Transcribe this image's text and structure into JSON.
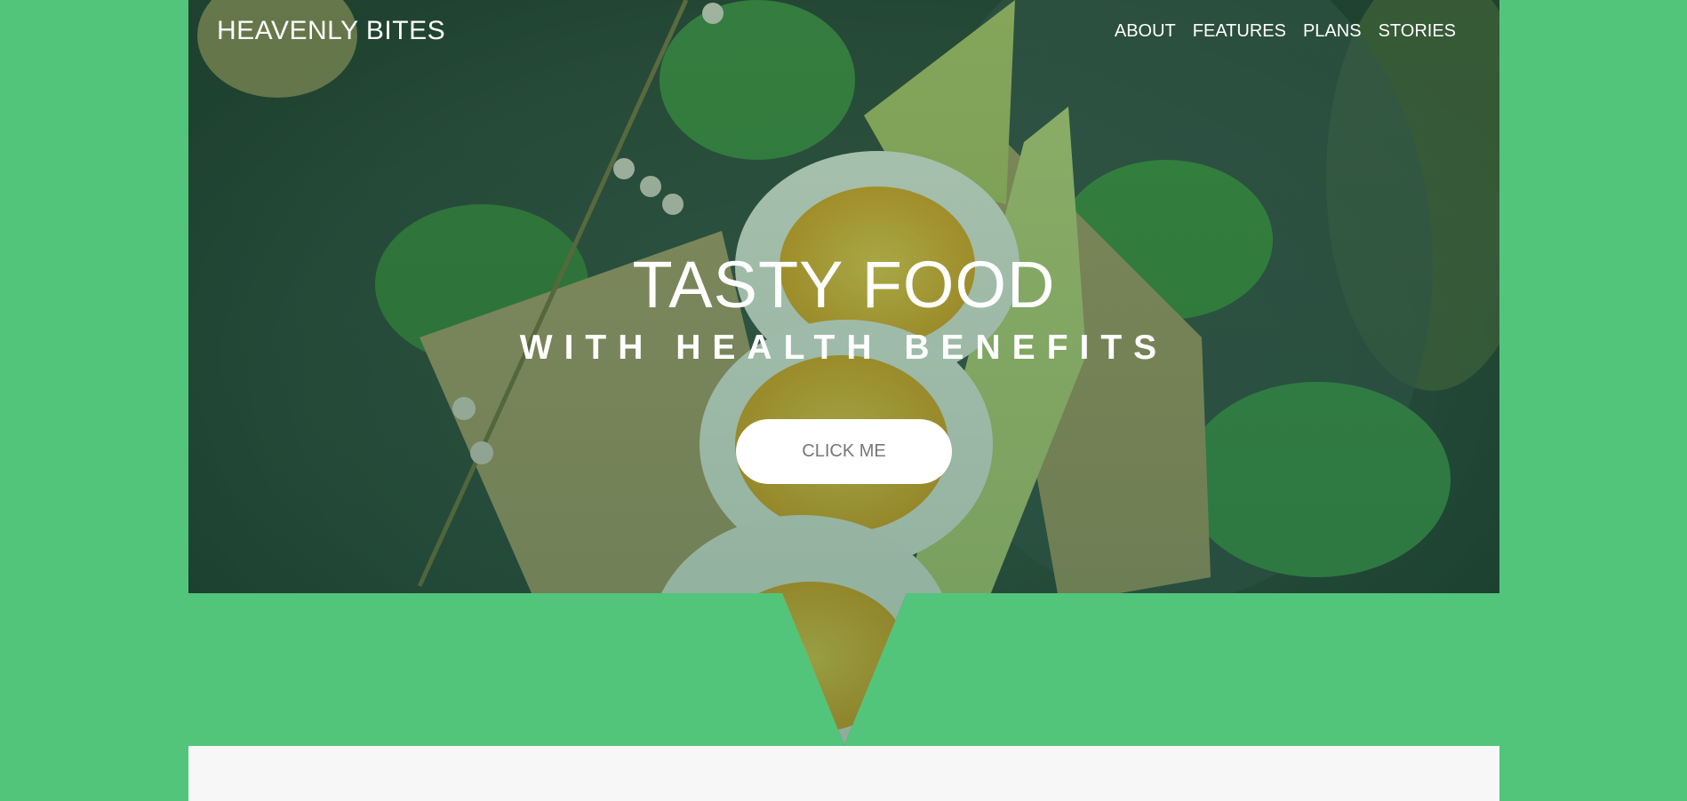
{
  "brand": {
    "name": "HEAVENLY BITES"
  },
  "nav": {
    "items": [
      {
        "label": "ABOUT"
      },
      {
        "label": "FEATURES"
      },
      {
        "label": "PLANS"
      },
      {
        "label": "STORIES"
      }
    ]
  },
  "hero": {
    "title": "TASTY FOOD",
    "subtitle": "WITH HEALTH BENEFITS",
    "cta_label": "CLICK ME"
  },
  "colors": {
    "background": "#52c57b",
    "content_background": "#f7f7f7",
    "text_light": "#ffffff",
    "button_text": "#777777"
  }
}
